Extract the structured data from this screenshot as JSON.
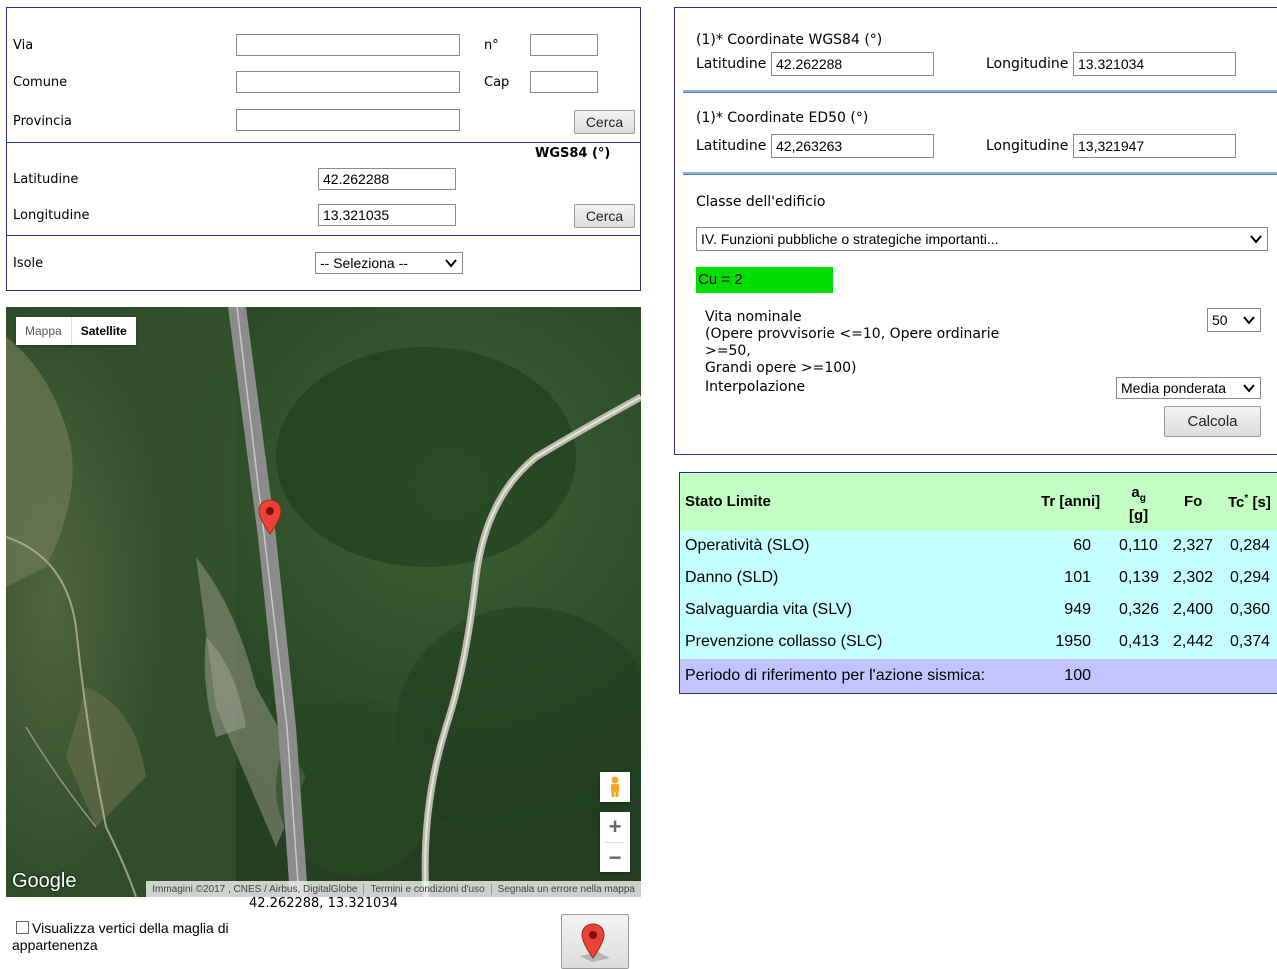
{
  "address": {
    "via_label": "Via",
    "num_label": "n°",
    "comune_label": "Comune",
    "cap_label": "Cap",
    "provincia_label": "Provincia",
    "search_button": "Cerca",
    "via_value": "",
    "num_value": "",
    "comune_value": "",
    "cap_value": "",
    "provincia_value": ""
  },
  "coords_search": {
    "system_label": "WGS84 (°)",
    "lat_label": "Latitudine",
    "lat_value": "42.262288",
    "lon_label": "Longitudine",
    "lon_value": "13.321035",
    "search_button": "Cerca"
  },
  "isole": {
    "label": "Isole",
    "selected": "-- Seleziona --"
  },
  "map": {
    "tab_map": "Mappa",
    "tab_satellite": "Satellite",
    "active_tab": "Satellite",
    "logo": "Google",
    "attribution": [
      "Immagini ©2017 , CNES / Airbus, DigitalGlobe",
      "Termini e condizioni d'uso",
      "Segnala un errore nella mappa"
    ],
    "zoom_in": "+",
    "zoom_out": "−",
    "coords_readout": "42.262288, 13.321034"
  },
  "vertices_checkbox": {
    "label": "Visualizza vertici della maglia di appartenenza",
    "checked": false
  },
  "right_panel": {
    "wgs84_header": "(1)* Coordinate WGS84 (°)",
    "wgs84_lat_label": "Latitudine",
    "wgs84_lat_value": "42.262288",
    "wgs84_lon_label": "Longitudine",
    "wgs84_lon_value": "13.321034",
    "ed50_header": "(1)* Coordinate ED50 (°)",
    "ed50_lat_label": "Latitudine",
    "ed50_lat_value": "42,263263",
    "ed50_lon_label": "Longitudine",
    "ed50_lon_value": "13,321947",
    "classe_label": "Classe dell'edificio",
    "classe_selected": "IV. Funzioni pubbliche o strategiche importanti...",
    "cu_badge": "Cu = 2",
    "cu_color": "#00dd00",
    "vita_line1": "Vita nominale",
    "vita_line2": "(Opere provvisorie <=10, Opere ordinarie",
    "vita_line3": ">=50,",
    "vita_line4": "Grandi opere >=100)",
    "vita_selected": "50",
    "interp_label": "Interpolazione",
    "interp_selected": "Media ponderata",
    "calc_button": "Calcola"
  },
  "results": {
    "headers": {
      "stato": "Stato Limite",
      "tr": "Tr [anni]",
      "ag": "a",
      "ag_sub": "g",
      "ag_unit": "[g]",
      "fo": "Fo",
      "tc": "Tc",
      "tc_sup": "*",
      "tc_unit": "[s]"
    },
    "rows": [
      {
        "stato": "Operatività (SLO)",
        "tr": "60",
        "ag": "0,110",
        "fo": "2,327",
        "tc": "0,284"
      },
      {
        "stato": "Danno (SLD)",
        "tr": "101",
        "ag": "0,139",
        "fo": "2,302",
        "tc": "0,294"
      },
      {
        "stato": "Salvaguardia vita (SLV)",
        "tr": "949",
        "ag": "0,326",
        "fo": "2,400",
        "tc": "0,360"
      },
      {
        "stato": "Prevenzione collasso (SLC)",
        "tr": "1950",
        "ag": "0,413",
        "fo": "2,442",
        "tc": "0,374"
      }
    ],
    "footer_label": "Periodo di riferimento per l'azione sismica:",
    "footer_value": "100",
    "colors": {
      "header": "#c2ffc2",
      "row": "#c6ffff",
      "footer": "#c3c3ff"
    }
  }
}
